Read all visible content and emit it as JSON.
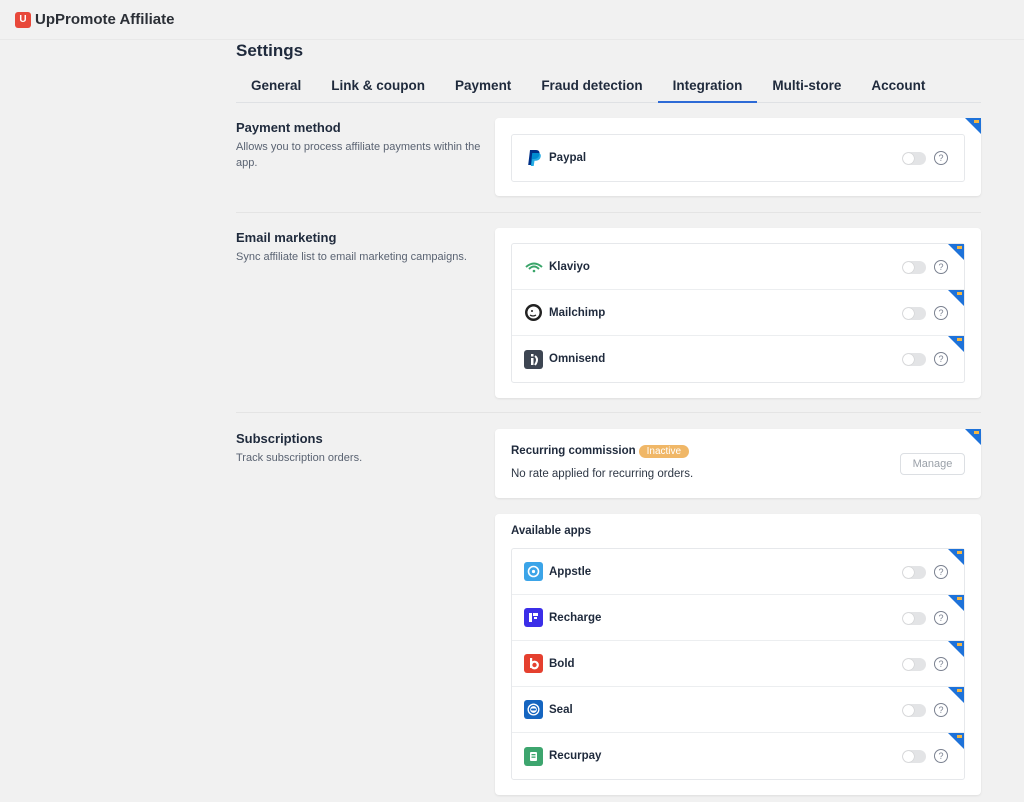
{
  "app": {
    "name": "UpPromote Affiliate",
    "logo_glyph": "U"
  },
  "page_title": "Settings",
  "tabs": [
    {
      "label": "General"
    },
    {
      "label": "Link & coupon"
    },
    {
      "label": "Payment"
    },
    {
      "label": "Fraud detection"
    },
    {
      "label": "Integration",
      "active": true
    },
    {
      "label": "Multi-store"
    },
    {
      "label": "Account"
    }
  ],
  "sections": {
    "payment": {
      "title": "Payment method",
      "desc": "Allows you to process affiliate payments within the app.",
      "apps": [
        {
          "name": "Paypal",
          "icon": "paypal-icon",
          "enabled": false
        }
      ]
    },
    "email": {
      "title": "Email marketing",
      "desc": "Sync affiliate list to email marketing campaigns.",
      "apps": [
        {
          "name": "Klaviyo",
          "icon": "klaviyo-icon",
          "enabled": false
        },
        {
          "name": "Mailchimp",
          "icon": "mailchimp-icon",
          "enabled": false
        },
        {
          "name": "Omnisend",
          "icon": "omnisend-icon",
          "enabled": false
        }
      ]
    },
    "subscriptions": {
      "title": "Subscriptions",
      "desc": "Track subscription orders.",
      "recurring": {
        "title": "Recurring commission",
        "badge": "Inactive",
        "desc": "No rate applied for recurring orders.",
        "button": "Manage"
      },
      "available_title": "Available apps",
      "apps": [
        {
          "name": "Appstle",
          "icon": "appstle-icon",
          "enabled": false
        },
        {
          "name": "Recharge",
          "icon": "recharge-icon",
          "enabled": false
        },
        {
          "name": "Bold",
          "icon": "bold-icon",
          "enabled": false
        },
        {
          "name": "Seal",
          "icon": "seal-icon",
          "enabled": false
        },
        {
          "name": "Recurpay",
          "icon": "recurpay-icon",
          "enabled": false
        }
      ]
    }
  },
  "help_glyph": "?",
  "colors": {
    "accent": "#2d6ad6",
    "corner_ribbon": "#1e72d9",
    "badge_inactive": "#f0b767",
    "brand": "#e8483a"
  }
}
